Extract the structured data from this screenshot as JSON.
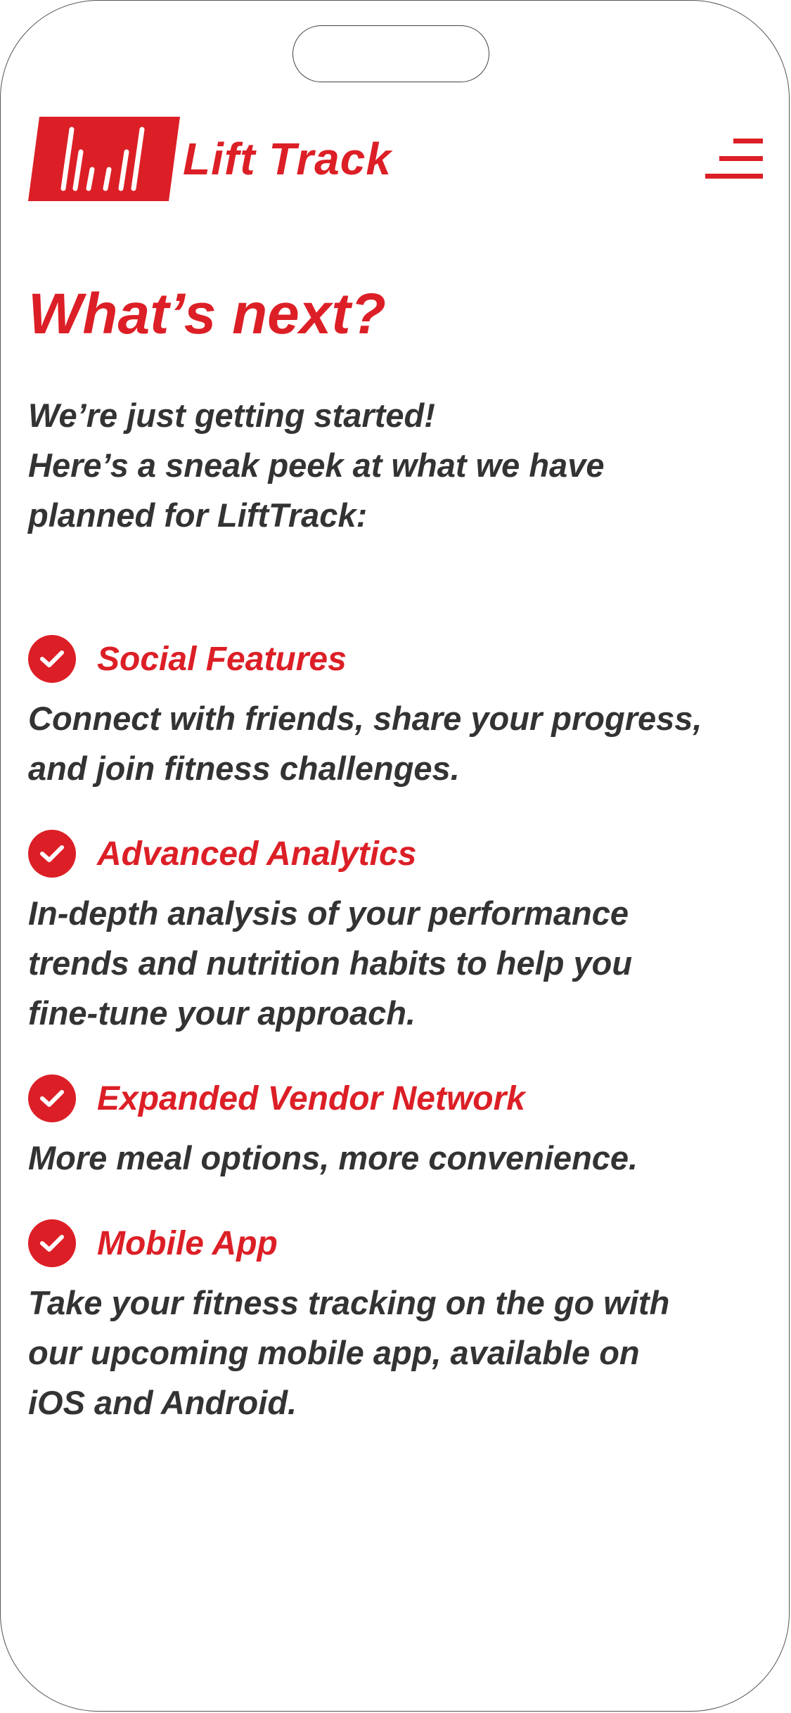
{
  "header": {
    "brand": "Lift Track",
    "menu_icon": "hamburger-icon"
  },
  "colors": {
    "accent": "#dc1f26",
    "text": "#333333"
  },
  "main": {
    "title": "What’s next?",
    "intro": "We’re just getting started!\nHere’s a sneak peek at what we have\nplanned for LiftTrack:",
    "features": [
      {
        "title": "Social Features",
        "description": "Connect with friends, share your progress,\nand join fitness challenges."
      },
      {
        "title": "Advanced Analytics",
        "description": "In-depth analysis of your performance\ntrends and nutrition habits to help you\nfine-tune your approach."
      },
      {
        "title": "Expanded Vendor Network",
        "description": "More meal options, more convenience."
      },
      {
        "title": "Mobile App",
        "description": "Take your fitness tracking on the go with\nour upcoming mobile app, available on\niOS and Android."
      }
    ]
  }
}
